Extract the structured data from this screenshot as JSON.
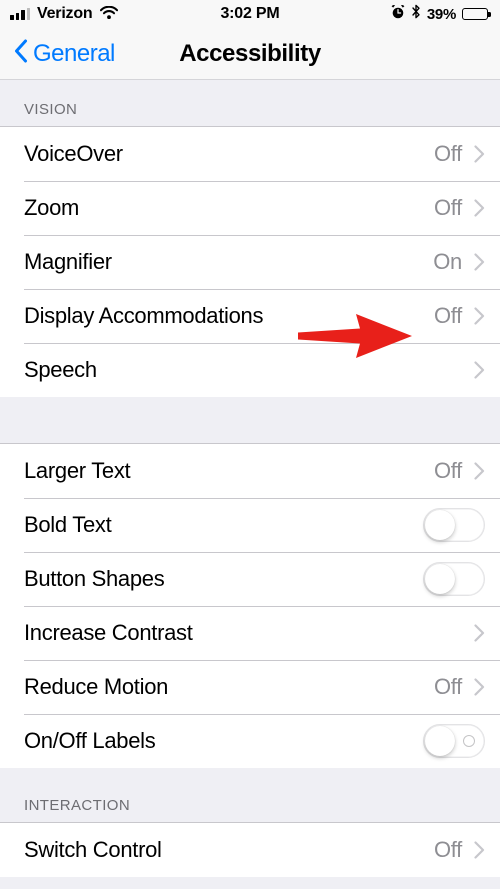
{
  "status_bar": {
    "carrier": "Verizon",
    "signal_icon": "signal-bars-icon",
    "wifi_icon": "wifi-icon",
    "time": "3:02 PM",
    "alarm_icon": "alarm-clock-icon",
    "bluetooth_icon": "bluetooth-icon",
    "battery_percent": "39%",
    "battery_level": 39
  },
  "nav": {
    "back_label": "General",
    "back_icon": "chevron-left-icon",
    "title": "Accessibility"
  },
  "colors": {
    "accent_blue": "#007AFF",
    "annotation_red": "#E8201A",
    "group_background": "#EFEFF4",
    "row_background": "#FFFFFF",
    "value_gray": "#8E8E93",
    "header_gray": "#6D6D72",
    "separator": "#C8C7CC"
  },
  "annotation": {
    "type": "arrow",
    "direction": "right",
    "color": "#E8201A",
    "points_at": "Display Accommodations"
  },
  "sections": [
    {
      "header": "VISION",
      "rows": [
        {
          "label": "VoiceOver",
          "value": "Off",
          "accessory": "chevron"
        },
        {
          "label": "Zoom",
          "value": "Off",
          "accessory": "chevron"
        },
        {
          "label": "Magnifier",
          "value": "On",
          "accessory": "chevron"
        },
        {
          "label": "Display Accommodations",
          "value": "Off",
          "accessory": "chevron"
        },
        {
          "label": "Speech",
          "value": "",
          "accessory": "chevron"
        }
      ]
    },
    {
      "header": "",
      "rows": [
        {
          "label": "Larger Text",
          "value": "Off",
          "accessory": "chevron"
        },
        {
          "label": "Bold Text",
          "value": "",
          "accessory": "toggle",
          "toggle_on": false,
          "toggle_off_label": false
        },
        {
          "label": "Button Shapes",
          "value": "",
          "accessory": "toggle",
          "toggle_on": false,
          "toggle_off_label": false
        },
        {
          "label": "Increase Contrast",
          "value": "",
          "accessory": "chevron"
        },
        {
          "label": "Reduce Motion",
          "value": "Off",
          "accessory": "chevron"
        },
        {
          "label": "On/Off Labels",
          "value": "",
          "accessory": "toggle",
          "toggle_on": false,
          "toggle_off_label": true
        }
      ]
    },
    {
      "header": "INTERACTION",
      "rows": [
        {
          "label": "Switch Control",
          "value": "Off",
          "accessory": "chevron"
        }
      ]
    }
  ]
}
